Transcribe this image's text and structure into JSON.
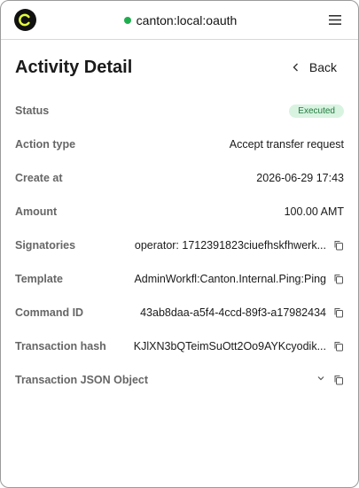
{
  "topbar": {
    "network": "canton:local:oauth",
    "status_color": "#1fae4f"
  },
  "header": {
    "title": "Activity Detail",
    "back_label": "Back"
  },
  "details": {
    "status": {
      "label": "Status",
      "value": "Executed"
    },
    "action_type": {
      "label": "Action type",
      "value": "Accept transfer request"
    },
    "created_at": {
      "label": "Create at",
      "value": "2026-06-29 17:43"
    },
    "amount": {
      "label": "Amount",
      "value": "100.00 AMT"
    },
    "signatories": {
      "label": "Signatories",
      "value": "operator: 1712391823ciuefhskfhwerk..."
    },
    "template": {
      "label": "Template",
      "value": "AdminWorkfl:Canton.Internal.Ping:Ping"
    },
    "command_id": {
      "label": "Command ID",
      "value": "43ab8daa-a5f4-4ccd-89f3-a17982434"
    },
    "transaction_hash": {
      "label": "Transaction hash",
      "value": "KJlXN3bQTeimSuOtt2Oo9AYKcyodik..."
    },
    "transaction_json": {
      "label": "Transaction JSON Object"
    }
  },
  "icons": {
    "logo": "canton-logo-icon",
    "menu": "hamburger-menu-icon",
    "back": "chevron-left-icon",
    "copy": "copy-icon",
    "expand": "chevron-down-icon"
  }
}
